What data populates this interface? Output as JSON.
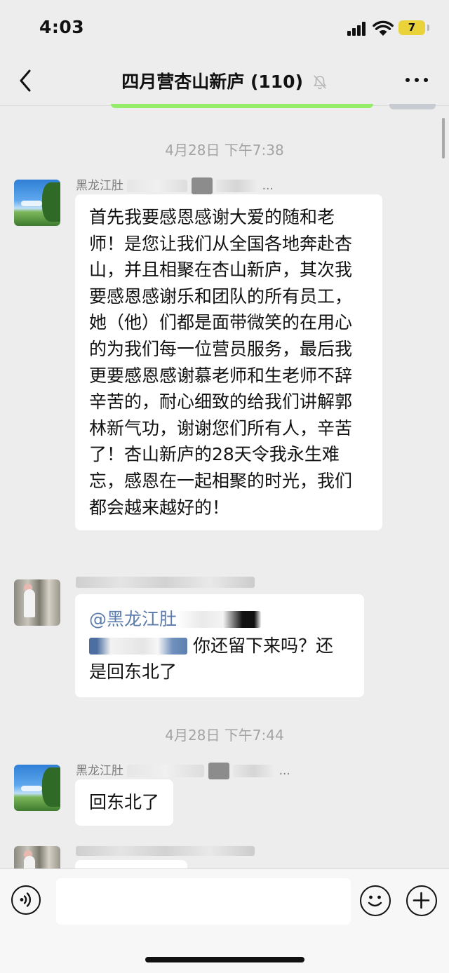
{
  "status_bar": {
    "time": "4:03",
    "battery": "7"
  },
  "nav": {
    "title": "四月营杏山新庐 (110)"
  },
  "icons": {
    "back": "chevron-left-icon",
    "mute": "bell-off-icon",
    "more": "ellipsis-icon",
    "voice": "voice-icon",
    "emoji": "emoji-icon",
    "plus": "plus-icon"
  },
  "colors": {
    "bubble_self": "#95ec69",
    "timestamp": "#a3a3a3",
    "mention": "#5c7cac"
  },
  "messages": {
    "timestamp_1": "4月28日 下午7:38",
    "m1": {
      "sender": "黑龙江肚",
      "sender_tail": "...",
      "text": "首先我要感恩感谢大爱的随和老师！是您让我们从全国各地奔赴杏山，并且相聚在杏山新庐，其次我要感恩感谢乐和团队的所有员工，她（他）们都是面带微笑的在用心的为我们每一位营员服务，最后我更要感恩感谢慕老师和生老师不辞辛苦的，耐心细致的给我们讲解郭林新气功，谢谢您们所有人，辛苦了！杏山新庐的28天令我永生难忘，感恩在一起相聚的时光，我们都会越来越好的！"
    },
    "m2": {
      "mention": "@黑龙江肚",
      "text_after": "你还留下来吗？还是回东北了"
    },
    "timestamp_2": "4月28日 下午7:44",
    "m3": {
      "sender": "黑龙江肚",
      "sender_tail": "...",
      "text": "回东北了"
    }
  },
  "input": {
    "placeholder": ""
  }
}
